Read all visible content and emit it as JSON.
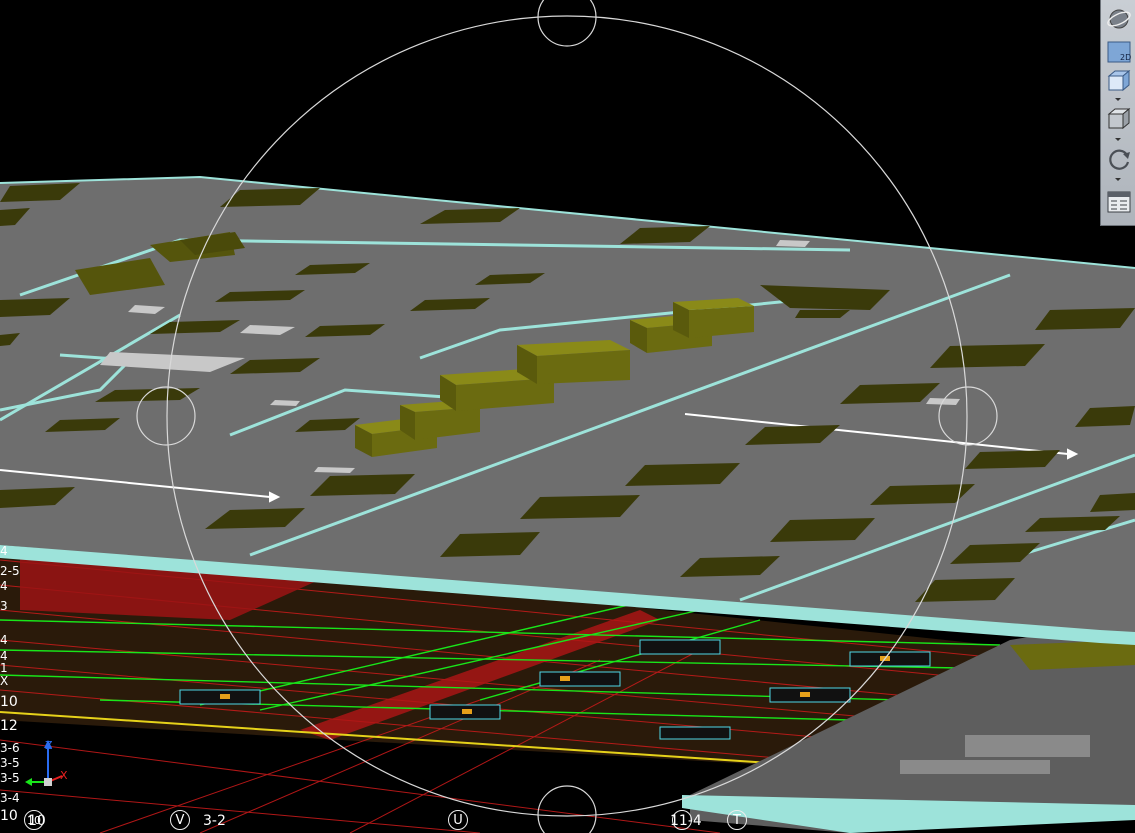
{
  "toolbar": {
    "items": [
      {
        "icon": "navigation-wheel-icon"
      },
      {
        "icon": "view-2d-icon",
        "label": "2D"
      },
      {
        "icon": "view-3d-box-icon"
      },
      {
        "icon": "view-solid-box-icon"
      },
      {
        "icon": "orbit-rotate-icon"
      },
      {
        "icon": "view-settings-panel-icon"
      }
    ]
  },
  "axis": {
    "z": "Z",
    "x": "X"
  },
  "side_labels": [
    "4",
    "2-5",
    "4",
    "3",
    "4",
    "4",
    "1",
    "X",
    "10",
    "12",
    "3-6",
    "3-5",
    "3-5",
    "3-4",
    "10"
  ],
  "bottom_grid": {
    "items": [
      {
        "bubble": "10",
        "label": "10"
      },
      {
        "bubble": "V",
        "label": "3-2"
      },
      {
        "bubble": "U",
        "label": ""
      },
      {
        "bubble": "",
        "label": "11-4"
      },
      {
        "bubble": "T",
        "label": ""
      }
    ]
  },
  "colors": {
    "slab": "#6e6e6e",
    "slab_edge": "#9de3da",
    "equipment": "#6b6b10",
    "equipment_dark": "#4a4a0a",
    "plan_grid": "#c41a1a",
    "plan_green": "#19e61a",
    "background": "#000000",
    "orbit_circle": "#d9d9d9"
  }
}
